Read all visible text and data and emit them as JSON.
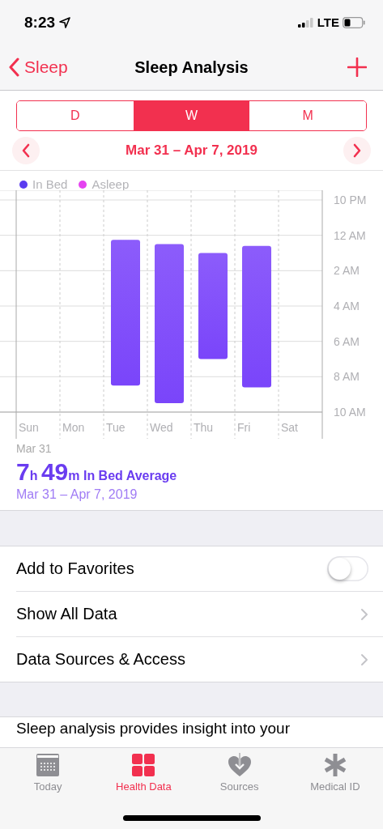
{
  "status_bar": {
    "time": "8:23",
    "network": "LTE"
  },
  "nav": {
    "back": "Sleep",
    "title": "Sleep Analysis"
  },
  "ranges": [
    {
      "label": "D",
      "selected": false
    },
    {
      "label": "W",
      "selected": true
    },
    {
      "label": "M",
      "selected": false
    }
  ],
  "period": {
    "label": "Mar 31 – Apr 7, 2019"
  },
  "legend": [
    {
      "label": "In Bed",
      "color": "#5b3cf0"
    },
    {
      "label": "Asleep",
      "color": "#e543f0"
    }
  ],
  "chart": {
    "time_labels": [
      "10 PM",
      "12 AM",
      "2 AM",
      "4 AM",
      "6 AM",
      "8 AM",
      "10 AM"
    ],
    "day_labels": [
      "Sun",
      "Mon",
      "Tue",
      "Wed",
      "Thu",
      "Fri",
      "Sat"
    ]
  },
  "summary": {
    "week_start": "Mar 31",
    "hours": "7",
    "hours_unit": "h",
    "minutes": "49",
    "minutes_unit": "m",
    "label": "In Bed Average",
    "range": "Mar 31 – Apr 7, 2019"
  },
  "rows": [
    {
      "kind": "toggle",
      "label": "Add to Favorites",
      "on": false
    },
    {
      "kind": "link",
      "label": "Show All Data"
    },
    {
      "kind": "link",
      "label": "Data Sources & Access"
    }
  ],
  "description": "Sleep analysis provides insight into your",
  "tabs": [
    {
      "label": "Today",
      "selected": false
    },
    {
      "label": "Health Data",
      "selected": true
    },
    {
      "label": "Sources",
      "selected": false
    },
    {
      "label": "Medical ID",
      "selected": false
    }
  ]
}
